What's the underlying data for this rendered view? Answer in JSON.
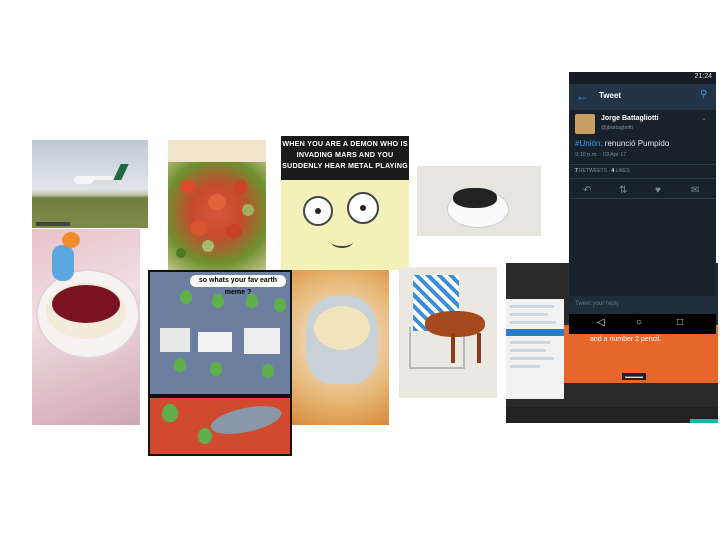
{
  "tiles": {
    "airplane": {
      "icon": "airplane-photo"
    },
    "salad": {
      "icon": "salad-photo"
    },
    "demon_meme": {
      "caption": "WHEN YOU ARE A DEMON WHO IS INVADING MARS AND YOU SUDDENLY HEAR METAL PLAYING"
    },
    "dog_bed": {
      "icon": "dog-sleeping-photo"
    },
    "cake": {
      "icon": "cake-photo"
    },
    "alien_meme": {
      "bubble": "so whats your fav earth meme ?"
    },
    "coffee": {
      "icon": "coffee-cup-photo"
    },
    "dog_chair": {
      "icon": "dog-on-chair-photo"
    },
    "laptop": {
      "slide_text": "and a number 2 pencil."
    }
  },
  "tweet_screen": {
    "status_time": "21:24",
    "bar_title": "Tweet",
    "author_name": "Jorge Battagliotti",
    "author_handle": "@jbattagliotti",
    "tweet_hashtag": "#Unión:",
    "tweet_text": " renunció Pumpido",
    "tweet_time": "9:10 p.m. · 03 Apr 17",
    "retweets_count": "7",
    "retweets_label": " RETWEETS · ",
    "likes_count": "4",
    "likes_label": " LIKES",
    "reply_placeholder": "Tweet your reply"
  }
}
